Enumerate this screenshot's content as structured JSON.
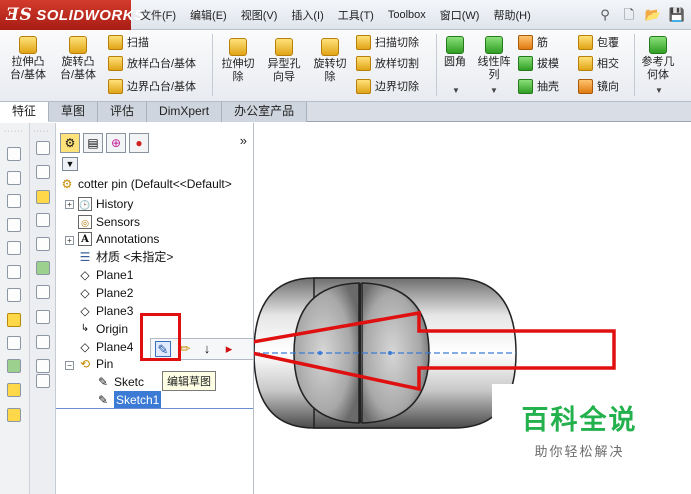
{
  "app": {
    "logo_prefix": "ƎS",
    "logo_text": "SOLIDWORKS"
  },
  "menu": [
    "文件(F)",
    "编辑(E)",
    "视图(V)",
    "插入(I)",
    "工具(T)",
    "Toolbox",
    "窗口(W)",
    "帮助(H)"
  ],
  "ribbon": {
    "extrude_boss": "拉伸凸\n台/基体",
    "revolve_boss": "旋转凸\n台/基体",
    "sweep": "扫描",
    "loft": "放样凸台/基体",
    "boundary_boss": "边界凸台/基体",
    "extrude_cut": "拉伸切\n除",
    "hole_wizard": "异型孔\n向导",
    "revolve_cut": "旋转切\n除",
    "sweep_cut": "扫描切除",
    "loft_cut": "放样切割",
    "boundary_cut": "边界切除",
    "fillet": "圆角",
    "linear_pattern": "线性阵\n列",
    "rib": "筋",
    "draft": "拔模",
    "shell": "抽壳",
    "wrap": "包覆",
    "intersect": "相交",
    "mirror": "镜向",
    "ref_geometry": "参考几\n何体"
  },
  "tabs": [
    "特征",
    "草图",
    "评估",
    "DimXpert",
    "办公室产品"
  ],
  "feature_tree": {
    "more": "»",
    "root": "cotter pin  (Default<<Default>",
    "items": {
      "history": "History",
      "sensors": "Sensors",
      "annotations": "Annotations",
      "material": "材质 <未指定>",
      "plane1": "Plane1",
      "plane2": "Plane2",
      "plane3": "Plane3",
      "origin": "Origin",
      "plane4": "Plane4",
      "pin": "Pin",
      "sketch_partial": "Sketc",
      "sketch1": "Sketch1"
    }
  },
  "tooltip": "编辑草图",
  "watermark": {
    "title": "百科全说",
    "subtitle": "助你轻松解决"
  }
}
